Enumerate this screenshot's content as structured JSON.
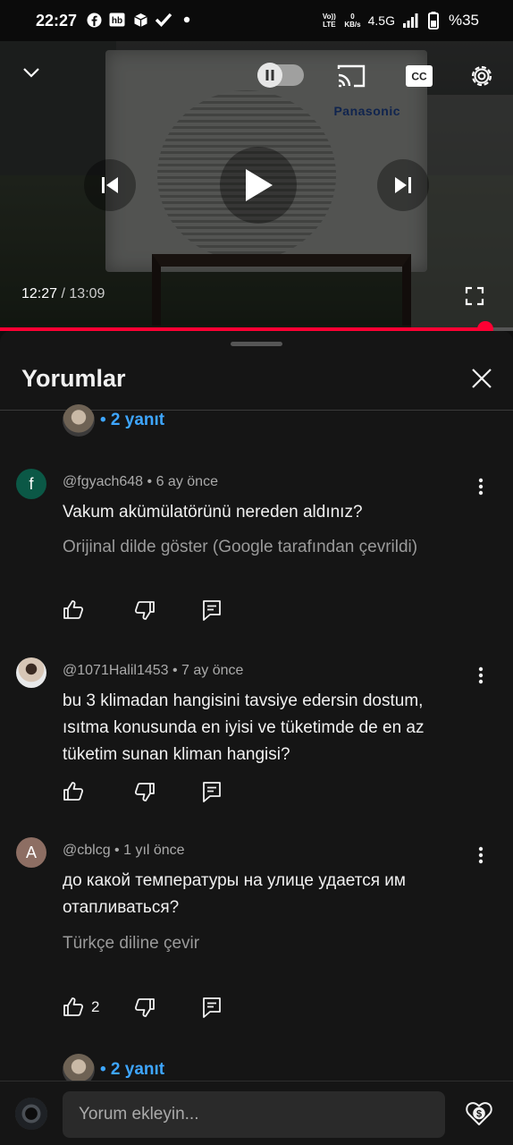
{
  "status_bar": {
    "time": "22:27",
    "left_icons": [
      "facebook-icon",
      "hb-icon",
      "box-icon",
      "check-icon",
      "dot-icon"
    ],
    "volte": "Vo)) LTE",
    "speed_value": "0",
    "speed_unit": "KB/s",
    "network": "4.5G",
    "battery": "%35"
  },
  "player": {
    "current_time": "12:27",
    "duration": "13:09",
    "time_separator": " / ",
    "progress_fraction": 0.946,
    "brand_text": "Panasonic",
    "controls": [
      "collapse-icon",
      "autoplay-toggle",
      "cast-icon",
      "captions-icon",
      "settings-icon",
      "previous-icon",
      "play-icon",
      "next-icon",
      "fullscreen-icon"
    ]
  },
  "comments_sheet": {
    "title": "Yorumlar",
    "top_replies": "• 2 yanıt",
    "comments": [
      {
        "avatar_letter": "f",
        "avatar_color": "#0b5846",
        "author": "@fgyach648",
        "time": "6 ay önce",
        "text": "Vakum akümülatörünü nereden aldınız?",
        "sub_action": "Orijinal dilde göster (Google tarafından çevrildi)",
        "likes": ""
      },
      {
        "avatar_letter": "",
        "avatar_color": "#cfd3d6",
        "author": "@1071Halil1453",
        "time": "7 ay önce",
        "text": "bu 3 klimadan hangisini tavsiye edersin dostum, ısıtma konusunda en iyisi ve tüketimde de en az tüketim sunan kliman hangisi?",
        "sub_action": "",
        "likes": ""
      },
      {
        "avatar_letter": "A",
        "avatar_color": "#8d6e63",
        "author": "@cblcg",
        "time": "1 yıl önce",
        "text": "до какой температуры на улице удается им отапливаться?",
        "sub_action": "Türkçe diline çevir",
        "likes": "2"
      }
    ],
    "bottom_replies": "• 2 yanıt"
  },
  "composer": {
    "placeholder": "Yorum ekleyin..."
  },
  "colors": {
    "accent_red": "#ff0033",
    "link_blue": "#3ea6ff",
    "sheet_bg": "#151515"
  }
}
